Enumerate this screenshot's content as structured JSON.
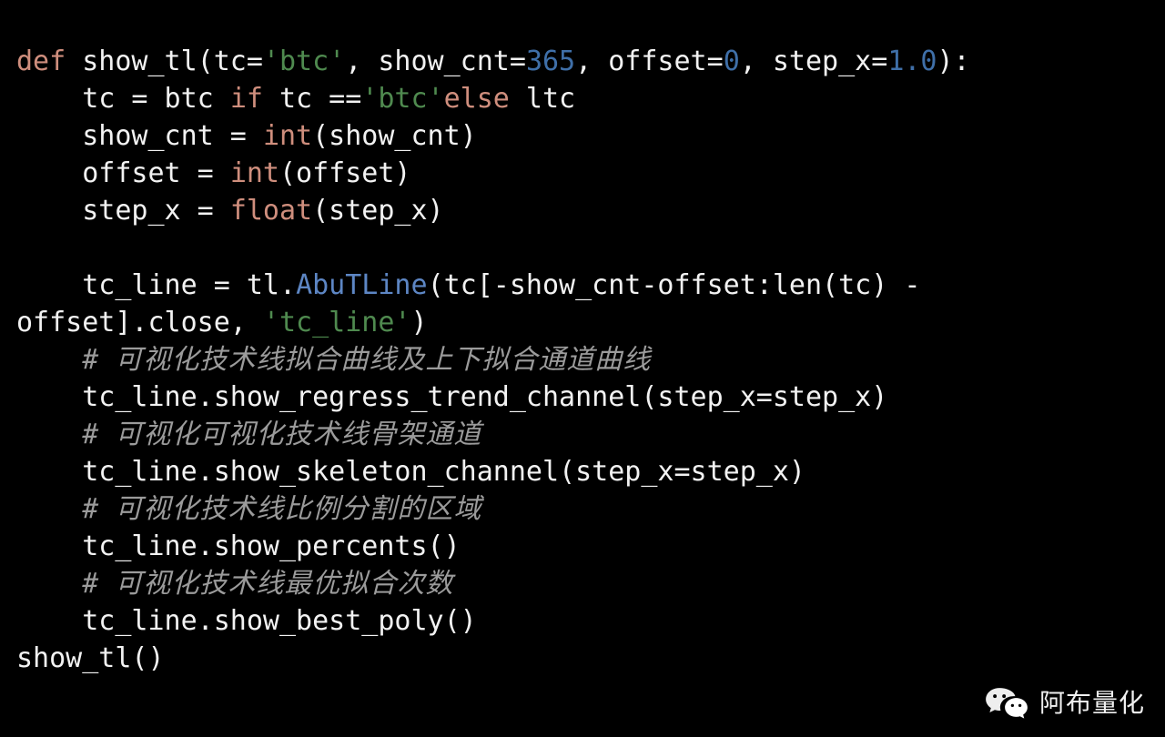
{
  "theme": {
    "background": "#000000",
    "foreground": "#f2f2f2",
    "keyword_color": "#cf8e7d",
    "builtin_color": "#cf8e7d",
    "string_color": "#4f8a4f",
    "number_color": "#3f6fa8",
    "class_color": "#5d86c4",
    "comment_color": "#9b9b9b",
    "font_size_px": 30,
    "line_height_px": 41
  },
  "code": {
    "language": "python",
    "lines": [
      {
        "id": "line-1-def",
        "indent": 0,
        "tokens": [
          {
            "t": "def",
            "c": "kw"
          },
          {
            "t": " show_tl(tc=",
            "c": "plain"
          },
          {
            "t": "'btc'",
            "c": "str"
          },
          {
            "t": ", show_cnt=",
            "c": "plain"
          },
          {
            "t": "365",
            "c": "num"
          },
          {
            "t": ", offset=",
            "c": "plain"
          },
          {
            "t": "0",
            "c": "num"
          },
          {
            "t": ", step_x=",
            "c": "plain"
          },
          {
            "t": "1.0",
            "c": "num"
          },
          {
            "t": "):",
            "c": "plain"
          }
        ]
      },
      {
        "id": "line-2-tc-assign",
        "indent": 4,
        "tokens": [
          {
            "t": "tc = btc ",
            "c": "plain"
          },
          {
            "t": "if",
            "c": "kw"
          },
          {
            "t": " tc ==",
            "c": "plain"
          },
          {
            "t": "'btc'",
            "c": "str"
          },
          {
            "t": "else",
            "c": "kw"
          },
          {
            "t": " ltc",
            "c": "plain"
          }
        ]
      },
      {
        "id": "line-3-show-cnt",
        "indent": 4,
        "tokens": [
          {
            "t": "show_cnt = ",
            "c": "plain"
          },
          {
            "t": "int",
            "c": "builtin"
          },
          {
            "t": "(show_cnt)",
            "c": "plain"
          }
        ]
      },
      {
        "id": "line-4-offset",
        "indent": 4,
        "tokens": [
          {
            "t": "offset = ",
            "c": "plain"
          },
          {
            "t": "int",
            "c": "builtin"
          },
          {
            "t": "(offset)",
            "c": "plain"
          }
        ]
      },
      {
        "id": "line-5-step-x",
        "indent": 4,
        "tokens": [
          {
            "t": "step_x = ",
            "c": "plain"
          },
          {
            "t": "float",
            "c": "builtin"
          },
          {
            "t": "(step_x)",
            "c": "plain"
          }
        ]
      },
      {
        "id": "line-6-blank",
        "indent": 0,
        "blank": true,
        "tokens": []
      },
      {
        "id": "line-7-tc-line",
        "indent": 4,
        "tokens": [
          {
            "t": "tc_line = tl.",
            "c": "plain"
          },
          {
            "t": "AbuTLine",
            "c": "cls"
          },
          {
            "t": "(tc[-show_cnt-offset:len(tc) - offset].close, ",
            "c": "plain"
          },
          {
            "t": "'tc_line'",
            "c": "str"
          },
          {
            "t": ")",
            "c": "plain"
          }
        ]
      },
      {
        "id": "line-8-comment-regress",
        "indent": 4,
        "tokens": [
          {
            "t": "# 可视化技术线拟合曲线及上下拟合通道曲线",
            "c": "comment"
          }
        ]
      },
      {
        "id": "line-9-regress-call",
        "indent": 4,
        "tokens": [
          {
            "t": "tc_line.show_regress_trend_channel(step_x=step_x)",
            "c": "plain"
          }
        ]
      },
      {
        "id": "line-10-comment-skeleton",
        "indent": 4,
        "tokens": [
          {
            "t": "# 可视化可视化技术线骨架通道",
            "c": "comment"
          }
        ]
      },
      {
        "id": "line-11-skeleton-call",
        "indent": 4,
        "tokens": [
          {
            "t": "tc_line.show_skeleton_channel(step_x=step_x)",
            "c": "plain"
          }
        ]
      },
      {
        "id": "line-12-comment-percents",
        "indent": 4,
        "tokens": [
          {
            "t": "# 可视化技术线比例分割的区域",
            "c": "comment"
          }
        ]
      },
      {
        "id": "line-13-percents-call",
        "indent": 4,
        "tokens": [
          {
            "t": "tc_line.show_percents()",
            "c": "plain"
          }
        ]
      },
      {
        "id": "line-14-comment-best-poly",
        "indent": 4,
        "tokens": [
          {
            "t": "# 可视化技术线最优拟合次数",
            "c": "comment"
          }
        ]
      },
      {
        "id": "line-15-best-poly-call",
        "indent": 4,
        "tokens": [
          {
            "t": "tc_line.show_best_poly()",
            "c": "plain"
          }
        ]
      },
      {
        "id": "line-16-invoke",
        "indent": 0,
        "tokens": [
          {
            "t": "show_tl()",
            "c": "plain"
          }
        ]
      }
    ]
  },
  "watermark": {
    "icon": "wechat-icon",
    "text": "阿布量化"
  }
}
